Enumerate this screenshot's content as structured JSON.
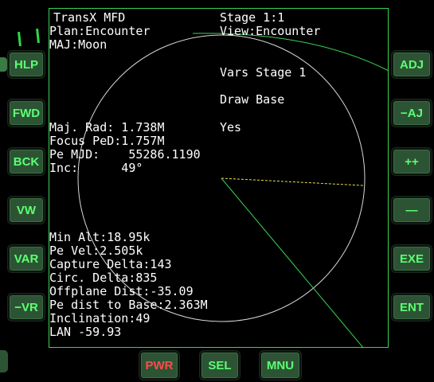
{
  "mfd": {
    "title": "TransX MFD",
    "stage": "Stage 1:1",
    "plan": "Plan:Encounter",
    "view": "View:Encounter",
    "maj": "MAJ:Moon",
    "vars_stage": "Vars Stage 1",
    "draw_base": "Draw Base",
    "maj_rad": "Maj. Rad: 1.738M",
    "maj_rad_flag": "Yes",
    "focus_ped": "Focus PeD:1.757M",
    "pe_mjd": "Pe MJD:    55286.1190",
    "inc": "Inc:      49°",
    "min_alt": "Min Alt:18.95k",
    "pe_vel": "Pe Vel:2.505k",
    "capture_delta": "Capture Delta:143",
    "circ_delta": "Circ. Delta:835",
    "offplane_dist": "Offplane Dist:-35.09",
    "pe_dist_base": "Pe dist to Base:2.363M",
    "inclination": "Inclination:49",
    "lan": "LAN -59.93"
  },
  "left_buttons": [
    "HLP",
    "FWD",
    "BCK",
    "VW",
    "VAR",
    "−VR"
  ],
  "right_buttons": [
    "ADJ",
    "−AJ",
    "++",
    "—",
    "EXE",
    "ENT"
  ],
  "bottom_buttons": [
    "PWR",
    "SEL",
    "MNU"
  ],
  "colors": {
    "button_face": "#2c5434",
    "button_text": "#5cff73",
    "power_text": "#ff4a4a",
    "frame": "#39d451",
    "screen_text": "#ffffff",
    "trajectory": "#39d451",
    "dashed_line": "#e8e04a"
  }
}
